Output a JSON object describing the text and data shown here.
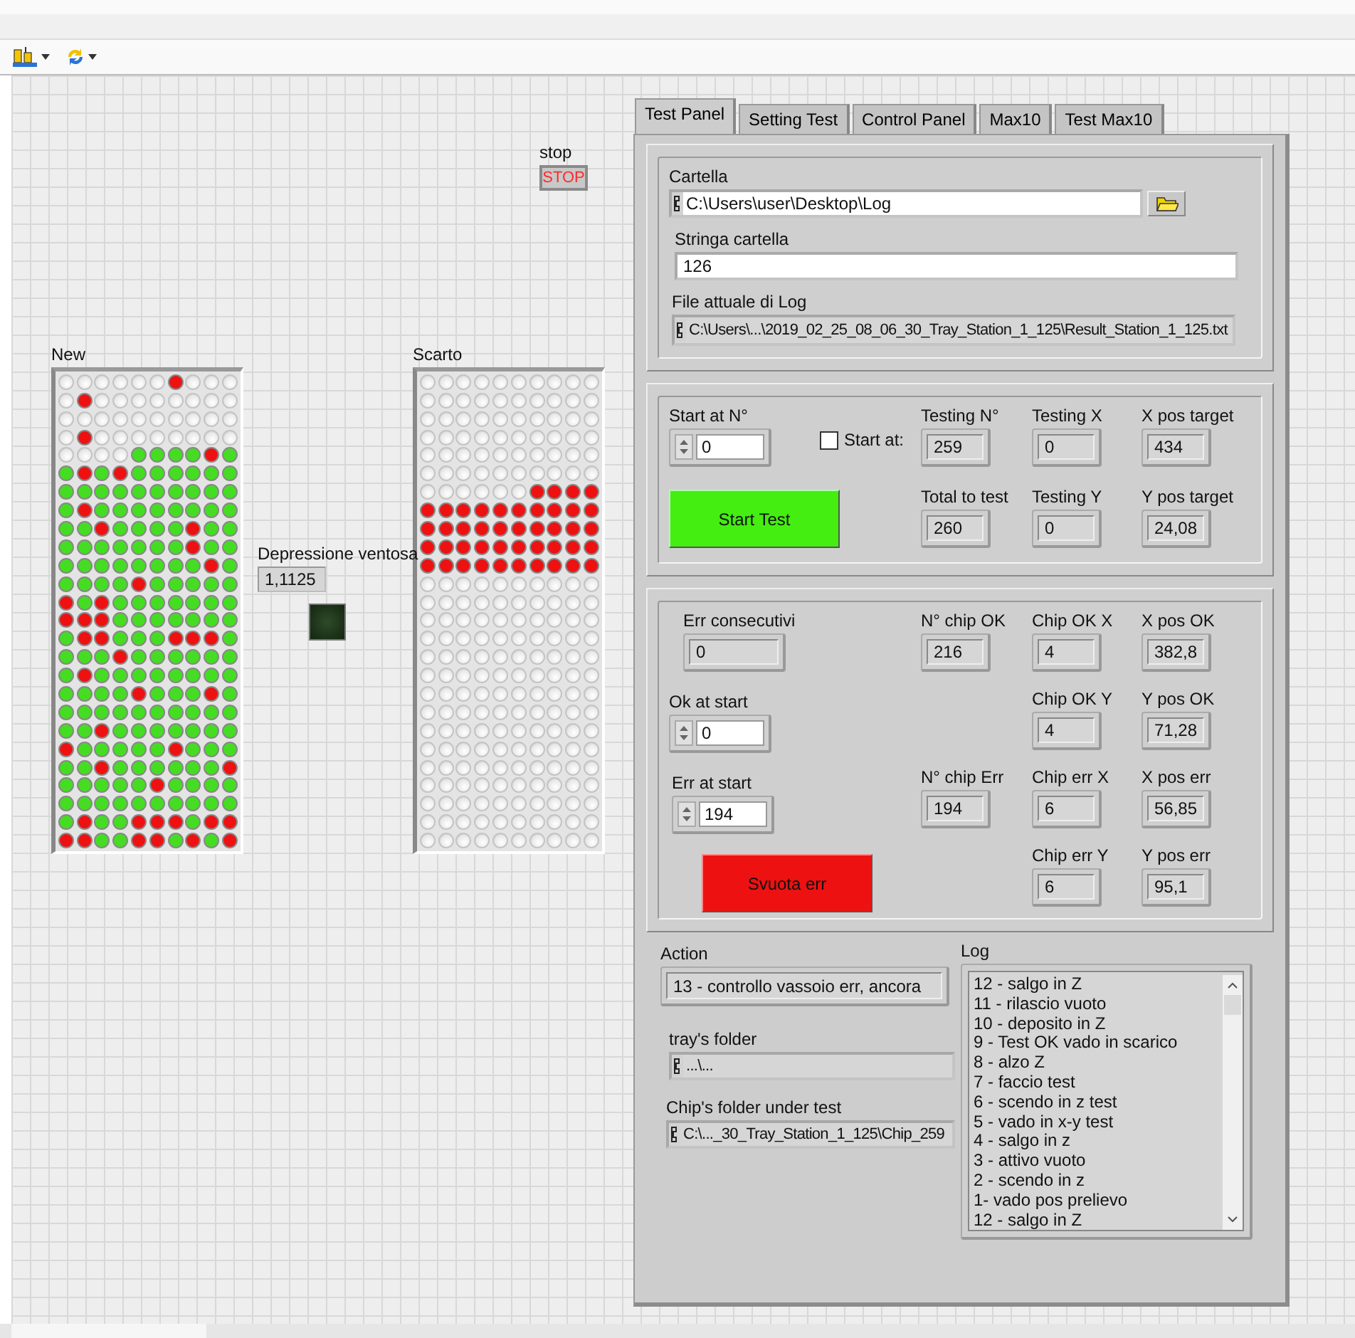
{
  "stop": {
    "label": "stop",
    "button": "STOP"
  },
  "new_tray": {
    "label": "New",
    "rows": [
      [
        {
          "lit": false
        },
        {
          "lit": false
        },
        {
          "lit": false
        },
        {
          "lit": false
        },
        {
          "lit": false
        },
        {
          "lit": false
        },
        {
          "lit": true,
          "color": "#ee1111"
        },
        {
          "lit": false
        },
        {
          "lit": false
        },
        {
          "lit": false
        }
      ],
      [
        {
          "lit": false
        },
        {
          "lit": true,
          "color": "#ee1111"
        },
        {
          "lit": false
        },
        {
          "lit": false
        },
        {
          "lit": false
        },
        {
          "lit": false
        },
        {
          "lit": false
        },
        {
          "lit": false
        },
        {
          "lit": false
        },
        {
          "lit": false
        }
      ],
      [
        {
          "lit": false
        },
        {
          "lit": false
        },
        {
          "lit": false
        },
        {
          "lit": false
        },
        {
          "lit": false
        },
        {
          "lit": false
        },
        {
          "lit": false
        },
        {
          "lit": false
        },
        {
          "lit": false
        },
        {
          "lit": false
        }
      ],
      [
        {
          "lit": false
        },
        {
          "lit": true,
          "color": "#ee1111"
        },
        {
          "lit": false
        },
        {
          "lit": false
        },
        {
          "lit": false
        },
        {
          "lit": false
        },
        {
          "lit": false
        },
        {
          "lit": false
        },
        {
          "lit": false
        },
        {
          "lit": false
        }
      ],
      [
        {
          "lit": false
        },
        {
          "lit": false
        },
        {
          "lit": false
        },
        {
          "lit": false
        },
        {
          "lit": true,
          "color": "#44dd22"
        },
        {
          "lit": true,
          "color": "#44dd22"
        },
        {
          "lit": true,
          "color": "#44dd22"
        },
        {
          "lit": true,
          "color": "#44dd22"
        },
        {
          "lit": true,
          "color": "#ee1111"
        },
        {
          "lit": true,
          "color": "#44dd22"
        }
      ],
      [
        {
          "lit": true,
          "color": "#44dd22"
        },
        {
          "lit": true,
          "color": "#ee1111"
        },
        {
          "lit": true,
          "color": "#44dd22"
        },
        {
          "lit": true,
          "color": "#ee1111"
        },
        {
          "lit": true,
          "color": "#44dd22"
        },
        {
          "lit": true,
          "color": "#44dd22"
        },
        {
          "lit": true,
          "color": "#44dd22"
        },
        {
          "lit": true,
          "color": "#44dd22"
        },
        {
          "lit": true,
          "color": "#44dd22"
        },
        {
          "lit": true,
          "color": "#44dd22"
        }
      ],
      [
        {
          "lit": true,
          "color": "#44dd22"
        },
        {
          "lit": true,
          "color": "#44dd22"
        },
        {
          "lit": true,
          "color": "#44dd22"
        },
        {
          "lit": true,
          "color": "#44dd22"
        },
        {
          "lit": true,
          "color": "#44dd22"
        },
        {
          "lit": true,
          "color": "#44dd22"
        },
        {
          "lit": true,
          "color": "#44dd22"
        },
        {
          "lit": true,
          "color": "#44dd22"
        },
        {
          "lit": true,
          "color": "#44dd22"
        },
        {
          "lit": true,
          "color": "#44dd22"
        }
      ],
      [
        {
          "lit": true,
          "color": "#44dd22"
        },
        {
          "lit": true,
          "color": "#ee1111"
        },
        {
          "lit": true,
          "color": "#44dd22"
        },
        {
          "lit": true,
          "color": "#44dd22"
        },
        {
          "lit": true,
          "color": "#44dd22"
        },
        {
          "lit": true,
          "color": "#44dd22"
        },
        {
          "lit": true,
          "color": "#44dd22"
        },
        {
          "lit": true,
          "color": "#44dd22"
        },
        {
          "lit": true,
          "color": "#44dd22"
        },
        {
          "lit": true,
          "color": "#44dd22"
        }
      ],
      [
        {
          "lit": true,
          "color": "#44dd22"
        },
        {
          "lit": true,
          "color": "#44dd22"
        },
        {
          "lit": true,
          "color": "#ee1111"
        },
        {
          "lit": true,
          "color": "#44dd22"
        },
        {
          "lit": true,
          "color": "#44dd22"
        },
        {
          "lit": true,
          "color": "#44dd22"
        },
        {
          "lit": true,
          "color": "#44dd22"
        },
        {
          "lit": true,
          "color": "#ee1111"
        },
        {
          "lit": true,
          "color": "#44dd22"
        },
        {
          "lit": true,
          "color": "#44dd22"
        }
      ],
      [
        {
          "lit": true,
          "color": "#44dd22"
        },
        {
          "lit": true,
          "color": "#44dd22"
        },
        {
          "lit": true,
          "color": "#44dd22"
        },
        {
          "lit": true,
          "color": "#44dd22"
        },
        {
          "lit": true,
          "color": "#44dd22"
        },
        {
          "lit": true,
          "color": "#44dd22"
        },
        {
          "lit": true,
          "color": "#44dd22"
        },
        {
          "lit": true,
          "color": "#ee1111"
        },
        {
          "lit": true,
          "color": "#44dd22"
        },
        {
          "lit": true,
          "color": "#44dd22"
        }
      ],
      [
        {
          "lit": true,
          "color": "#44dd22"
        },
        {
          "lit": true,
          "color": "#44dd22"
        },
        {
          "lit": true,
          "color": "#44dd22"
        },
        {
          "lit": true,
          "color": "#44dd22"
        },
        {
          "lit": true,
          "color": "#44dd22"
        },
        {
          "lit": true,
          "color": "#44dd22"
        },
        {
          "lit": true,
          "color": "#44dd22"
        },
        {
          "lit": true,
          "color": "#44dd22"
        },
        {
          "lit": true,
          "color": "#ee1111"
        },
        {
          "lit": true,
          "color": "#44dd22"
        }
      ],
      [
        {
          "lit": true,
          "color": "#44dd22"
        },
        {
          "lit": true,
          "color": "#44dd22"
        },
        {
          "lit": true,
          "color": "#44dd22"
        },
        {
          "lit": true,
          "color": "#44dd22"
        },
        {
          "lit": true,
          "color": "#ee1111"
        },
        {
          "lit": true,
          "color": "#44dd22"
        },
        {
          "lit": true,
          "color": "#44dd22"
        },
        {
          "lit": true,
          "color": "#44dd22"
        },
        {
          "lit": true,
          "color": "#44dd22"
        },
        {
          "lit": true,
          "color": "#44dd22"
        }
      ],
      [
        {
          "lit": true,
          "color": "#ee1111"
        },
        {
          "lit": true,
          "color": "#44dd22"
        },
        {
          "lit": true,
          "color": "#ee1111"
        },
        {
          "lit": true,
          "color": "#44dd22"
        },
        {
          "lit": true,
          "color": "#44dd22"
        },
        {
          "lit": true,
          "color": "#44dd22"
        },
        {
          "lit": true,
          "color": "#44dd22"
        },
        {
          "lit": true,
          "color": "#44dd22"
        },
        {
          "lit": true,
          "color": "#44dd22"
        },
        {
          "lit": true,
          "color": "#44dd22"
        }
      ],
      [
        {
          "lit": true,
          "color": "#ee1111"
        },
        {
          "lit": true,
          "color": "#ee1111"
        },
        {
          "lit": true,
          "color": "#ee1111"
        },
        {
          "lit": true,
          "color": "#44dd22"
        },
        {
          "lit": true,
          "color": "#44dd22"
        },
        {
          "lit": true,
          "color": "#44dd22"
        },
        {
          "lit": true,
          "color": "#44dd22"
        },
        {
          "lit": true,
          "color": "#44dd22"
        },
        {
          "lit": true,
          "color": "#44dd22"
        },
        {
          "lit": true,
          "color": "#44dd22"
        }
      ],
      [
        {
          "lit": true,
          "color": "#44dd22"
        },
        {
          "lit": true,
          "color": "#ee1111"
        },
        {
          "lit": true,
          "color": "#ee1111"
        },
        {
          "lit": true,
          "color": "#44dd22"
        },
        {
          "lit": true,
          "color": "#44dd22"
        },
        {
          "lit": true,
          "color": "#44dd22"
        },
        {
          "lit": true,
          "color": "#ee1111"
        },
        {
          "lit": true,
          "color": "#ee1111"
        },
        {
          "lit": true,
          "color": "#ee1111"
        },
        {
          "lit": true,
          "color": "#44dd22"
        }
      ],
      [
        {
          "lit": true,
          "color": "#44dd22"
        },
        {
          "lit": true,
          "color": "#44dd22"
        },
        {
          "lit": true,
          "color": "#44dd22"
        },
        {
          "lit": true,
          "color": "#ee1111"
        },
        {
          "lit": true,
          "color": "#44dd22"
        },
        {
          "lit": true,
          "color": "#44dd22"
        },
        {
          "lit": true,
          "color": "#44dd22"
        },
        {
          "lit": true,
          "color": "#44dd22"
        },
        {
          "lit": true,
          "color": "#44dd22"
        },
        {
          "lit": true,
          "color": "#44dd22"
        }
      ],
      [
        {
          "lit": true,
          "color": "#44dd22"
        },
        {
          "lit": true,
          "color": "#ee1111"
        },
        {
          "lit": true,
          "color": "#44dd22"
        },
        {
          "lit": true,
          "color": "#44dd22"
        },
        {
          "lit": true,
          "color": "#44dd22"
        },
        {
          "lit": true,
          "color": "#44dd22"
        },
        {
          "lit": true,
          "color": "#44dd22"
        },
        {
          "lit": true,
          "color": "#44dd22"
        },
        {
          "lit": true,
          "color": "#44dd22"
        },
        {
          "lit": true,
          "color": "#44dd22"
        }
      ],
      [
        {
          "lit": true,
          "color": "#44dd22"
        },
        {
          "lit": true,
          "color": "#44dd22"
        },
        {
          "lit": true,
          "color": "#44dd22"
        },
        {
          "lit": true,
          "color": "#44dd22"
        },
        {
          "lit": true,
          "color": "#ee1111"
        },
        {
          "lit": true,
          "color": "#44dd22"
        },
        {
          "lit": true,
          "color": "#44dd22"
        },
        {
          "lit": true,
          "color": "#44dd22"
        },
        {
          "lit": true,
          "color": "#ee1111"
        },
        {
          "lit": true,
          "color": "#44dd22"
        }
      ],
      [
        {
          "lit": true,
          "color": "#44dd22"
        },
        {
          "lit": true,
          "color": "#44dd22"
        },
        {
          "lit": true,
          "color": "#44dd22"
        },
        {
          "lit": true,
          "color": "#44dd22"
        },
        {
          "lit": true,
          "color": "#44dd22"
        },
        {
          "lit": true,
          "color": "#44dd22"
        },
        {
          "lit": true,
          "color": "#44dd22"
        },
        {
          "lit": true,
          "color": "#44dd22"
        },
        {
          "lit": true,
          "color": "#44dd22"
        },
        {
          "lit": true,
          "color": "#44dd22"
        }
      ],
      [
        {
          "lit": true,
          "color": "#44dd22"
        },
        {
          "lit": true,
          "color": "#44dd22"
        },
        {
          "lit": true,
          "color": "#ee1111"
        },
        {
          "lit": true,
          "color": "#44dd22"
        },
        {
          "lit": true,
          "color": "#44dd22"
        },
        {
          "lit": true,
          "color": "#44dd22"
        },
        {
          "lit": true,
          "color": "#44dd22"
        },
        {
          "lit": true,
          "color": "#44dd22"
        },
        {
          "lit": true,
          "color": "#44dd22"
        },
        {
          "lit": true,
          "color": "#44dd22"
        }
      ],
      [
        {
          "lit": true,
          "color": "#ee1111"
        },
        {
          "lit": true,
          "color": "#44dd22"
        },
        {
          "lit": true,
          "color": "#44dd22"
        },
        {
          "lit": true,
          "color": "#44dd22"
        },
        {
          "lit": true,
          "color": "#44dd22"
        },
        {
          "lit": true,
          "color": "#44dd22"
        },
        {
          "lit": true,
          "color": "#ee1111"
        },
        {
          "lit": true,
          "color": "#44dd22"
        },
        {
          "lit": true,
          "color": "#44dd22"
        },
        {
          "lit": true,
          "color": "#44dd22"
        }
      ],
      [
        {
          "lit": true,
          "color": "#44dd22"
        },
        {
          "lit": true,
          "color": "#44dd22"
        },
        {
          "lit": true,
          "color": "#ee1111"
        },
        {
          "lit": true,
          "color": "#44dd22"
        },
        {
          "lit": true,
          "color": "#44dd22"
        },
        {
          "lit": true,
          "color": "#44dd22"
        },
        {
          "lit": true,
          "color": "#44dd22"
        },
        {
          "lit": true,
          "color": "#44dd22"
        },
        {
          "lit": true,
          "color": "#44dd22"
        },
        {
          "lit": true,
          "color": "#ee1111"
        }
      ],
      [
        {
          "lit": true,
          "color": "#44dd22"
        },
        {
          "lit": true,
          "color": "#44dd22"
        },
        {
          "lit": true,
          "color": "#44dd22"
        },
        {
          "lit": true,
          "color": "#44dd22"
        },
        {
          "lit": true,
          "color": "#44dd22"
        },
        {
          "lit": true,
          "color": "#ee1111"
        },
        {
          "lit": true,
          "color": "#44dd22"
        },
        {
          "lit": true,
          "color": "#44dd22"
        },
        {
          "lit": true,
          "color": "#44dd22"
        },
        {
          "lit": true,
          "color": "#44dd22"
        }
      ],
      [
        {
          "lit": true,
          "color": "#44dd22"
        },
        {
          "lit": true,
          "color": "#44dd22"
        },
        {
          "lit": true,
          "color": "#44dd22"
        },
        {
          "lit": true,
          "color": "#44dd22"
        },
        {
          "lit": true,
          "color": "#44dd22"
        },
        {
          "lit": true,
          "color": "#44dd22"
        },
        {
          "lit": true,
          "color": "#44dd22"
        },
        {
          "lit": true,
          "color": "#44dd22"
        },
        {
          "lit": true,
          "color": "#44dd22"
        },
        {
          "lit": true,
          "color": "#44dd22"
        }
      ],
      [
        {
          "lit": true,
          "color": "#44dd22"
        },
        {
          "lit": true,
          "color": "#ee1111"
        },
        {
          "lit": true,
          "color": "#44dd22"
        },
        {
          "lit": true,
          "color": "#44dd22"
        },
        {
          "lit": true,
          "color": "#ee1111"
        },
        {
          "lit": true,
          "color": "#ee1111"
        },
        {
          "lit": true,
          "color": "#ee1111"
        },
        {
          "lit": true,
          "color": "#44dd22"
        },
        {
          "lit": true,
          "color": "#ee1111"
        },
        {
          "lit": true,
          "color": "#ee1111"
        }
      ],
      [
        {
          "lit": true,
          "color": "#ee1111"
        },
        {
          "lit": true,
          "color": "#ee1111"
        },
        {
          "lit": true,
          "color": "#44dd22"
        },
        {
          "lit": true,
          "color": "#44dd22"
        },
        {
          "lit": true,
          "color": "#ee1111"
        },
        {
          "lit": true,
          "color": "#ee1111"
        },
        {
          "lit": true,
          "color": "#44dd22"
        },
        {
          "lit": true,
          "color": "#ee1111"
        },
        {
          "lit": true,
          "color": "#44dd22"
        },
        {
          "lit": true,
          "color": "#ee1111"
        }
      ]
    ]
  },
  "depressione": {
    "label": "Depressione ventosa",
    "value": "1,1125",
    "led_on": false
  },
  "scarto": {
    "label": "Scarto",
    "rows": [
      [
        {
          "lit": false
        },
        {
          "lit": false
        },
        {
          "lit": false
        },
        {
          "lit": false
        },
        {
          "lit": false
        },
        {
          "lit": false
        },
        {
          "lit": false
        },
        {
          "lit": false
        },
        {
          "lit": false
        },
        {
          "lit": false
        }
      ],
      [
        {
          "lit": false
        },
        {
          "lit": false
        },
        {
          "lit": false
        },
        {
          "lit": false
        },
        {
          "lit": false
        },
        {
          "lit": false
        },
        {
          "lit": false
        },
        {
          "lit": false
        },
        {
          "lit": false
        },
        {
          "lit": false
        }
      ],
      [
        {
          "lit": false
        },
        {
          "lit": false
        },
        {
          "lit": false
        },
        {
          "lit": false
        },
        {
          "lit": false
        },
        {
          "lit": false
        },
        {
          "lit": false
        },
        {
          "lit": false
        },
        {
          "lit": false
        },
        {
          "lit": false
        }
      ],
      [
        {
          "lit": false
        },
        {
          "lit": false
        },
        {
          "lit": false
        },
        {
          "lit": false
        },
        {
          "lit": false
        },
        {
          "lit": false
        },
        {
          "lit": false
        },
        {
          "lit": false
        },
        {
          "lit": false
        },
        {
          "lit": false
        }
      ],
      [
        {
          "lit": false
        },
        {
          "lit": false
        },
        {
          "lit": false
        },
        {
          "lit": false
        },
        {
          "lit": false
        },
        {
          "lit": false
        },
        {
          "lit": false
        },
        {
          "lit": false
        },
        {
          "lit": false
        },
        {
          "lit": false
        }
      ],
      [
        {
          "lit": false
        },
        {
          "lit": false
        },
        {
          "lit": false
        },
        {
          "lit": false
        },
        {
          "lit": false
        },
        {
          "lit": false
        },
        {
          "lit": false
        },
        {
          "lit": false
        },
        {
          "lit": false
        },
        {
          "lit": false
        }
      ],
      [
        {
          "lit": false
        },
        {
          "lit": false
        },
        {
          "lit": false
        },
        {
          "lit": false
        },
        {
          "lit": false
        },
        {
          "lit": false
        },
        {
          "lit": true,
          "color": "#ee1111"
        },
        {
          "lit": true,
          "color": "#ee1111"
        },
        {
          "lit": true,
          "color": "#ee1111"
        },
        {
          "lit": true,
          "color": "#ee1111"
        }
      ],
      [
        {
          "lit": true,
          "color": "#ee1111"
        },
        {
          "lit": true,
          "color": "#ee1111"
        },
        {
          "lit": true,
          "color": "#ee1111"
        },
        {
          "lit": true,
          "color": "#ee1111"
        },
        {
          "lit": true,
          "color": "#ee1111"
        },
        {
          "lit": true,
          "color": "#ee1111"
        },
        {
          "lit": true,
          "color": "#ee1111"
        },
        {
          "lit": true,
          "color": "#ee1111"
        },
        {
          "lit": true,
          "color": "#ee1111"
        },
        {
          "lit": true,
          "color": "#ee1111"
        }
      ],
      [
        {
          "lit": true,
          "color": "#ee1111"
        },
        {
          "lit": true,
          "color": "#ee1111"
        },
        {
          "lit": true,
          "color": "#ee1111"
        },
        {
          "lit": true,
          "color": "#ee1111"
        },
        {
          "lit": true,
          "color": "#ee1111"
        },
        {
          "lit": true,
          "color": "#ee1111"
        },
        {
          "lit": true,
          "color": "#ee1111"
        },
        {
          "lit": true,
          "color": "#ee1111"
        },
        {
          "lit": true,
          "color": "#ee1111"
        },
        {
          "lit": true,
          "color": "#ee1111"
        }
      ],
      [
        {
          "lit": true,
          "color": "#ee1111"
        },
        {
          "lit": true,
          "color": "#ee1111"
        },
        {
          "lit": true,
          "color": "#ee1111"
        },
        {
          "lit": true,
          "color": "#ee1111"
        },
        {
          "lit": true,
          "color": "#ee1111"
        },
        {
          "lit": true,
          "color": "#ee1111"
        },
        {
          "lit": true,
          "color": "#ee1111"
        },
        {
          "lit": true,
          "color": "#ee1111"
        },
        {
          "lit": true,
          "color": "#ee1111"
        },
        {
          "lit": true,
          "color": "#ee1111"
        }
      ],
      [
        {
          "lit": true,
          "color": "#ee1111"
        },
        {
          "lit": true,
          "color": "#ee1111"
        },
        {
          "lit": true,
          "color": "#ee1111"
        },
        {
          "lit": true,
          "color": "#ee1111"
        },
        {
          "lit": true,
          "color": "#ee1111"
        },
        {
          "lit": true,
          "color": "#ee1111"
        },
        {
          "lit": true,
          "color": "#ee1111"
        },
        {
          "lit": true,
          "color": "#ee1111"
        },
        {
          "lit": true,
          "color": "#ee1111"
        },
        {
          "lit": true,
          "color": "#ee1111"
        }
      ],
      [
        {
          "lit": false
        },
        {
          "lit": false
        },
        {
          "lit": false
        },
        {
          "lit": false
        },
        {
          "lit": false
        },
        {
          "lit": false
        },
        {
          "lit": false
        },
        {
          "lit": false
        },
        {
          "lit": false
        },
        {
          "lit": false
        }
      ],
      [
        {
          "lit": false
        },
        {
          "lit": false
        },
        {
          "lit": false
        },
        {
          "lit": false
        },
        {
          "lit": false
        },
        {
          "lit": false
        },
        {
          "lit": false
        },
        {
          "lit": false
        },
        {
          "lit": false
        },
        {
          "lit": false
        }
      ],
      [
        {
          "lit": false
        },
        {
          "lit": false
        },
        {
          "lit": false
        },
        {
          "lit": false
        },
        {
          "lit": false
        },
        {
          "lit": false
        },
        {
          "lit": false
        },
        {
          "lit": false
        },
        {
          "lit": false
        },
        {
          "lit": false
        }
      ],
      [
        {
          "lit": false
        },
        {
          "lit": false
        },
        {
          "lit": false
        },
        {
          "lit": false
        },
        {
          "lit": false
        },
        {
          "lit": false
        },
        {
          "lit": false
        },
        {
          "lit": false
        },
        {
          "lit": false
        },
        {
          "lit": false
        }
      ],
      [
        {
          "lit": false
        },
        {
          "lit": false
        },
        {
          "lit": false
        },
        {
          "lit": false
        },
        {
          "lit": false
        },
        {
          "lit": false
        },
        {
          "lit": false
        },
        {
          "lit": false
        },
        {
          "lit": false
        },
        {
          "lit": false
        }
      ],
      [
        {
          "lit": false
        },
        {
          "lit": false
        },
        {
          "lit": false
        },
        {
          "lit": false
        },
        {
          "lit": false
        },
        {
          "lit": false
        },
        {
          "lit": false
        },
        {
          "lit": false
        },
        {
          "lit": false
        },
        {
          "lit": false
        }
      ],
      [
        {
          "lit": false
        },
        {
          "lit": false
        },
        {
          "lit": false
        },
        {
          "lit": false
        },
        {
          "lit": false
        },
        {
          "lit": false
        },
        {
          "lit": false
        },
        {
          "lit": false
        },
        {
          "lit": false
        },
        {
          "lit": false
        }
      ],
      [
        {
          "lit": false
        },
        {
          "lit": false
        },
        {
          "lit": false
        },
        {
          "lit": false
        },
        {
          "lit": false
        },
        {
          "lit": false
        },
        {
          "lit": false
        },
        {
          "lit": false
        },
        {
          "lit": false
        },
        {
          "lit": false
        }
      ],
      [
        {
          "lit": false
        },
        {
          "lit": false
        },
        {
          "lit": false
        },
        {
          "lit": false
        },
        {
          "lit": false
        },
        {
          "lit": false
        },
        {
          "lit": false
        },
        {
          "lit": false
        },
        {
          "lit": false
        },
        {
          "lit": false
        }
      ],
      [
        {
          "lit": false
        },
        {
          "lit": false
        },
        {
          "lit": false
        },
        {
          "lit": false
        },
        {
          "lit": false
        },
        {
          "lit": false
        },
        {
          "lit": false
        },
        {
          "lit": false
        },
        {
          "lit": false
        },
        {
          "lit": false
        }
      ],
      [
        {
          "lit": false
        },
        {
          "lit": false
        },
        {
          "lit": false
        },
        {
          "lit": false
        },
        {
          "lit": false
        },
        {
          "lit": false
        },
        {
          "lit": false
        },
        {
          "lit": false
        },
        {
          "lit": false
        },
        {
          "lit": false
        }
      ],
      [
        {
          "lit": false
        },
        {
          "lit": false
        },
        {
          "lit": false
        },
        {
          "lit": false
        },
        {
          "lit": false
        },
        {
          "lit": false
        },
        {
          "lit": false
        },
        {
          "lit": false
        },
        {
          "lit": false
        },
        {
          "lit": false
        }
      ],
      [
        {
          "lit": false
        },
        {
          "lit": false
        },
        {
          "lit": false
        },
        {
          "lit": false
        },
        {
          "lit": false
        },
        {
          "lit": false
        },
        {
          "lit": false
        },
        {
          "lit": false
        },
        {
          "lit": false
        },
        {
          "lit": false
        }
      ],
      [
        {
          "lit": false
        },
        {
          "lit": false
        },
        {
          "lit": false
        },
        {
          "lit": false
        },
        {
          "lit": false
        },
        {
          "lit": false
        },
        {
          "lit": false
        },
        {
          "lit": false
        },
        {
          "lit": false
        },
        {
          "lit": false
        }
      ],
      [
        {
          "lit": false
        },
        {
          "lit": false
        },
        {
          "lit": false
        },
        {
          "lit": false
        },
        {
          "lit": false
        },
        {
          "lit": false
        },
        {
          "lit": false
        },
        {
          "lit": false
        },
        {
          "lit": false
        },
        {
          "lit": false
        }
      ]
    ]
  },
  "tabs": [
    {
      "label": "Test Panel",
      "selected": true
    },
    {
      "label": "Setting Test",
      "selected": false
    },
    {
      "label": "Control Panel",
      "selected": false
    },
    {
      "label": "Max10",
      "selected": false
    },
    {
      "label": "Test Max10",
      "selected": false
    }
  ],
  "folder_group": {
    "cartella": {
      "label": "Cartella",
      "value": "C:\\Users\\user\\Desktop\\Log"
    },
    "stringa_cartella": {
      "label": "Stringa cartella",
      "value": "126"
    },
    "file_log": {
      "label": "File attuale di Log",
      "value": "C:\\Users\\...\\2019_02_25_08_06_30_Tray_Station_1_125\\Result_Station_1_125.txt"
    }
  },
  "test_group": {
    "start_at_n": {
      "label": "Start at N°",
      "value": "0"
    },
    "start_at_checkbox": {
      "label": "Start at:",
      "checked": false
    },
    "start_button": "Start Test",
    "indicators": [
      {
        "label": "Testing N°",
        "value": "259"
      },
      {
        "label": "Testing X",
        "value": "0"
      },
      {
        "label": "X pos target",
        "value": "434"
      },
      {
        "label": "Total to test",
        "value": "260"
      },
      {
        "label": "Testing Y",
        "value": "0"
      },
      {
        "label": "Y pos target",
        "value": "24,08"
      }
    ]
  },
  "result_group": {
    "err_consecutivi": {
      "label": "Err consecutivi",
      "value": "0"
    },
    "ok_at_start": {
      "label": "Ok at start",
      "value": "0"
    },
    "err_at_start": {
      "label": "Err at start",
      "value": "194"
    },
    "svuota_button": "Svuota err",
    "chip_counts": [
      {
        "label": "N° chip OK",
        "value": "216"
      },
      {
        "label": "N° chip Err",
        "value": "194"
      }
    ],
    "chip_positions": [
      {
        "label": "Chip OK X",
        "value": "4"
      },
      {
        "label": "Chip OK Y",
        "value": "4"
      },
      {
        "label": "Chip err X",
        "value": "6"
      },
      {
        "label": "Chip err Y",
        "value": "6"
      }
    ],
    "mm_positions": [
      {
        "label": "X pos OK",
        "value": "382,8"
      },
      {
        "label": "Y pos OK",
        "value": "71,28"
      },
      {
        "label": "X pos err",
        "value": "56,85"
      },
      {
        "label": "Y pos err",
        "value": "95,1"
      }
    ]
  },
  "action": {
    "label": "Action",
    "value": "13 - controllo vassoio err, ancora"
  },
  "trays_folder": {
    "label": "tray's folder",
    "value": "...\\..."
  },
  "chips_folder": {
    "label": "Chip's folder under test",
    "value": "C:\\..._30_Tray_Station_1_125\\Chip_259"
  },
  "log": {
    "label": "Log",
    "lines": [
      "12 - salgo in Z",
      "11 - rilascio vuoto",
      "10 - deposito in Z",
      "9 - Test OK vado in scarico",
      "8 - alzo Z",
      "7 - faccio test",
      "6 - scendo in z test",
      "5 - vado in x-y test",
      "4 - salgo in z",
      "3 - attivo vuoto",
      "2 - scendo in z",
      "1- vado pos prelievo",
      "12 - salgo in Z"
    ]
  }
}
